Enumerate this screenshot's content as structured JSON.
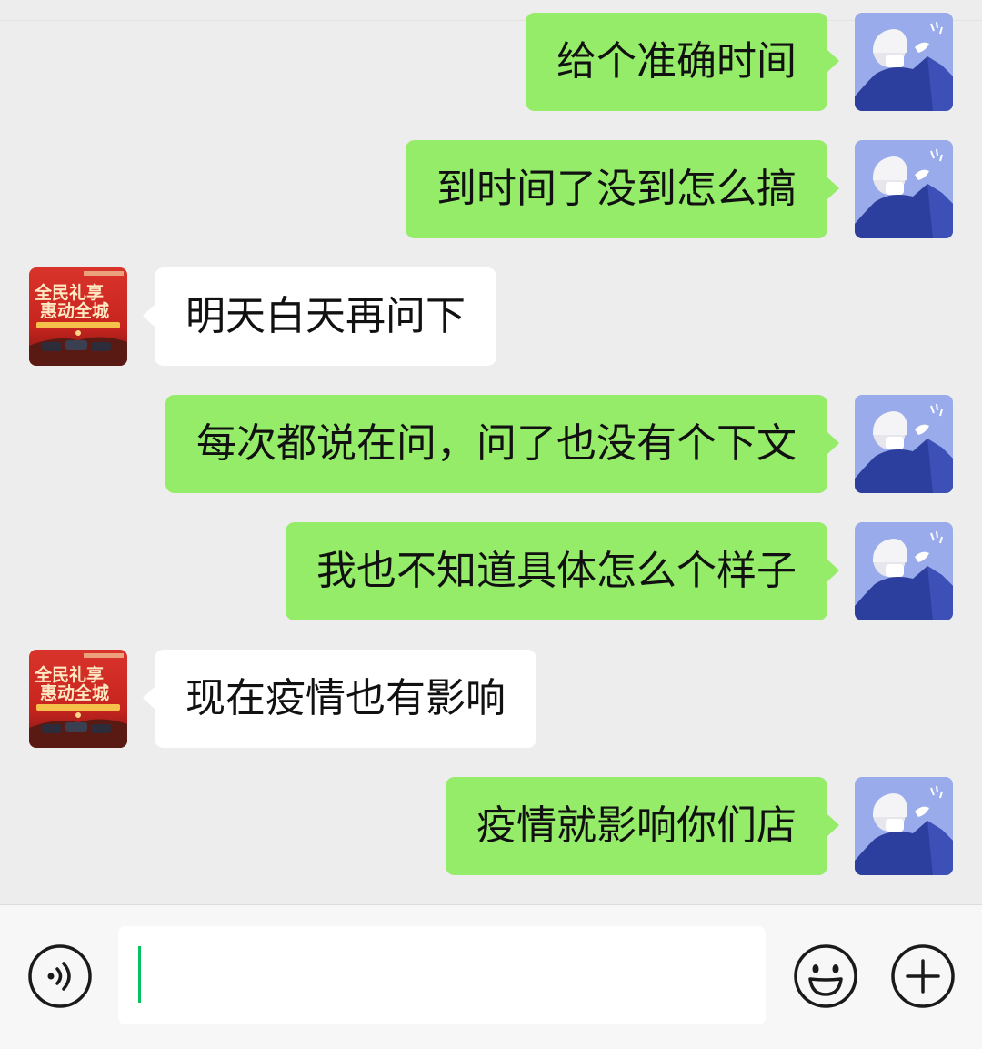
{
  "colors": {
    "background": "#ededed",
    "outgoing_bubble": "#95ec69",
    "incoming_bubble": "#ffffff",
    "caret": "#07c160"
  },
  "messages": [
    {
      "direction": "out",
      "text": "给个准确时间",
      "avatar": "user-avatar"
    },
    {
      "direction": "out",
      "text": "到时间了没到怎么搞",
      "avatar": "user-avatar"
    },
    {
      "direction": "in",
      "text": "明天白天再问下",
      "avatar": "dealer-avatar"
    },
    {
      "direction": "out",
      "text": "每次都说在问，问了也没有个下文",
      "avatar": "user-avatar"
    },
    {
      "direction": "out",
      "text": "我也不知道具体怎么个样子",
      "avatar": "user-avatar"
    },
    {
      "direction": "in",
      "text": "现在疫情也有影响",
      "avatar": "dealer-avatar"
    },
    {
      "direction": "out",
      "text": "疫情就影响你们店",
      "avatar": "user-avatar"
    }
  ],
  "dealer_avatar": {
    "line1": "全民礼享",
    "line2": "惠动全城"
  },
  "input_bar": {
    "value": "",
    "icons": [
      "voice-icon",
      "emoji-icon",
      "plus-icon"
    ]
  }
}
